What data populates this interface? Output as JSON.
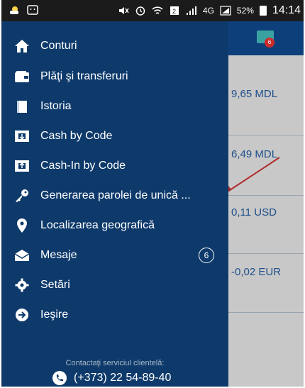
{
  "status_bar": {
    "battery_percent": "52%",
    "time": "14:14",
    "network": "4G"
  },
  "menu": {
    "items": [
      {
        "label": "Conturi",
        "icon": "home-icon"
      },
      {
        "label": "Plăţi şi transferuri",
        "icon": "wallet-icon"
      },
      {
        "label": "Istoria",
        "icon": "book-icon"
      },
      {
        "label": "Cash by Code",
        "icon": "cash-by-code-icon"
      },
      {
        "label": "Cash-In by Code",
        "icon": "cash-in-icon"
      },
      {
        "label": "Generarea parolei de unică ...",
        "icon": "key-icon"
      },
      {
        "label": "Localizarea geografică",
        "icon": "location-pin-icon"
      },
      {
        "label": "Mesaje",
        "icon": "envelope-icon",
        "badge": "6"
      },
      {
        "label": "Setări",
        "icon": "gear-icon"
      },
      {
        "label": "Ieşire",
        "icon": "exit-arrow-icon"
      }
    ]
  },
  "footer": {
    "contact_label": "Contactaţi serviciul clientelă:",
    "phone": "(+373) 22 54-89-40"
  },
  "background": {
    "amounts": [
      "9,65 MDL",
      "6,49 MDL",
      "0,11 USD",
      "-0,02 EUR"
    ],
    "mail_badge": "6"
  },
  "colors": {
    "drawer_bg": "#0e3a6b",
    "header_bg": "#0d3f7a",
    "status_bar": "#1b1b1b",
    "amount_text": "#1f4f8a"
  }
}
